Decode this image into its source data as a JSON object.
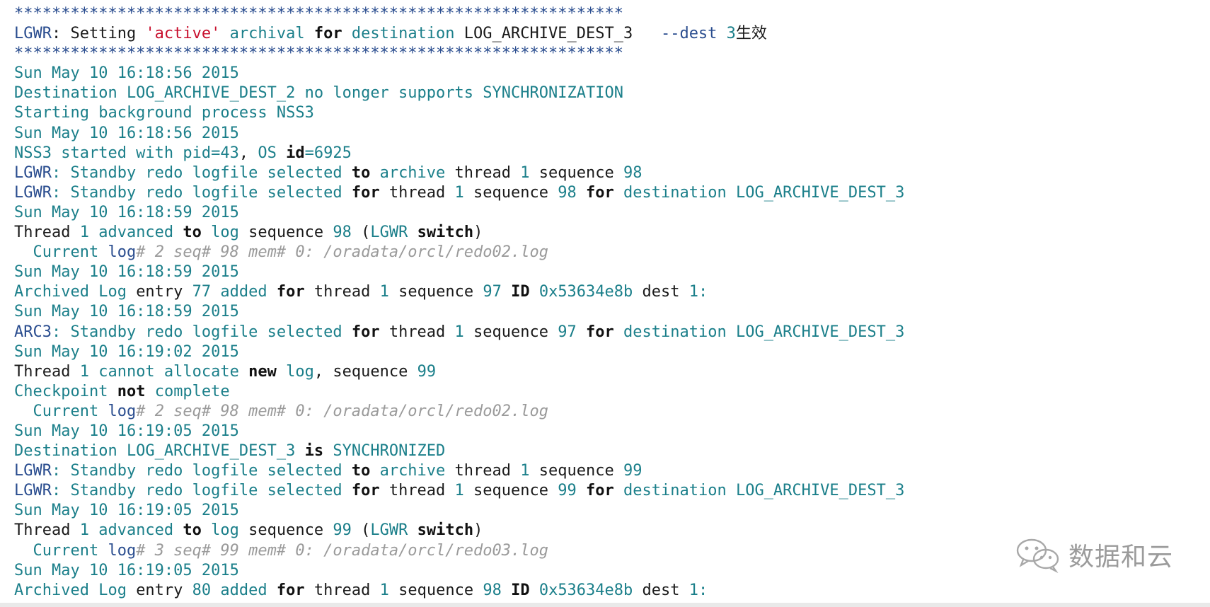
{
  "colors": {
    "d": "#1a1a1a",
    "t": "#1b7f8a",
    "n": "#2a4d8f",
    "k": "#111111",
    "s": "#c8102e",
    "c": "#9a9a9a"
  },
  "lines": [
    [
      [
        "z",
        "*****************************************************************"
      ]
    ],
    [
      [
        "n",
        "LGWR"
      ],
      [
        "d",
        ": Setting "
      ],
      [
        "s",
        "'active'"
      ],
      [
        "t",
        " archival "
      ],
      [
        "k",
        "for"
      ],
      [
        "t",
        " destination "
      ],
      [
        "d",
        "LOG_ARCHIVE_DEST_3   "
      ],
      [
        "n",
        "--dest "
      ],
      [
        "t",
        "3"
      ],
      [
        "d",
        "生效"
      ]
    ],
    [
      [
        "z",
        "*****************************************************************"
      ]
    ],
    [
      [
        "t",
        "Sun May 10 16:18:56 2015"
      ]
    ],
    [
      [
        "t",
        "Destination LOG_ARCHIVE_DEST_2 no longer supports SYNCHRONIZATION"
      ]
    ],
    [
      [
        "t",
        "Starting background process NSS3"
      ]
    ],
    [
      [
        "t",
        "Sun May 10 16:18:56 2015"
      ]
    ],
    [
      [
        "t",
        "NSS3 started with pid="
      ],
      [
        "t",
        "43"
      ],
      [
        "d",
        ", "
      ],
      [
        "t",
        "OS "
      ],
      [
        "k",
        "id"
      ],
      [
        "t",
        "=6925"
      ]
    ],
    [
      [
        "n",
        "LGWR"
      ],
      [
        "t",
        ": Standby redo logfile selected "
      ],
      [
        "k",
        "to"
      ],
      [
        "t",
        " archive "
      ],
      [
        "d",
        "thread "
      ],
      [
        "t",
        "1 "
      ],
      [
        "d",
        "sequence "
      ],
      [
        "t",
        "98"
      ]
    ],
    [
      [
        "n",
        "LGWR"
      ],
      [
        "t",
        ": Standby redo logfile selected "
      ],
      [
        "k",
        "for"
      ],
      [
        "d",
        " thread "
      ],
      [
        "t",
        "1 "
      ],
      [
        "d",
        "sequence "
      ],
      [
        "t",
        "98 "
      ],
      [
        "k",
        "for"
      ],
      [
        "t",
        " destination LOG_ARCHIVE_DEST_3"
      ]
    ],
    [
      [
        "t",
        "Sun May 10 16:18:59 2015"
      ]
    ],
    [
      [
        "d",
        "Thread "
      ],
      [
        "t",
        "1 advanced "
      ],
      [
        "k",
        "to"
      ],
      [
        "t",
        " log "
      ],
      [
        "d",
        "sequence "
      ],
      [
        "t",
        "98 "
      ],
      [
        "d",
        "("
      ],
      [
        "t",
        "LGWR "
      ],
      [
        "k",
        "switch"
      ],
      [
        "d",
        ")"
      ]
    ],
    [
      [
        "t",
        "  Current "
      ],
      [
        "n",
        "log"
      ],
      [
        "c",
        "# 2 seq# 98 mem# 0: /oradata/orcl/redo02.log"
      ]
    ],
    [
      [
        "t",
        "Sun May 10 16:18:59 2015"
      ]
    ],
    [
      [
        "t",
        "Archived Log "
      ],
      [
        "d",
        "entry "
      ],
      [
        "t",
        "77 added "
      ],
      [
        "k",
        "for"
      ],
      [
        "d",
        " thread "
      ],
      [
        "t",
        "1 "
      ],
      [
        "d",
        "sequence "
      ],
      [
        "t",
        "97 "
      ],
      [
        "k",
        "ID"
      ],
      [
        "t",
        " 0x53634e8b "
      ],
      [
        "d",
        "dest "
      ],
      [
        "t",
        "1:"
      ]
    ],
    [
      [
        "t",
        "Sun May 10 16:18:59 2015"
      ]
    ],
    [
      [
        "n",
        "ARC3"
      ],
      [
        "t",
        ": Standby redo logfile selected "
      ],
      [
        "k",
        "for"
      ],
      [
        "d",
        " thread "
      ],
      [
        "t",
        "1 "
      ],
      [
        "d",
        "sequence "
      ],
      [
        "t",
        "97 "
      ],
      [
        "k",
        "for"
      ],
      [
        "t",
        " destination LOG_ARCHIVE_DEST_3"
      ]
    ],
    [
      [
        "t",
        "Sun May 10 16:19:02 2015"
      ]
    ],
    [
      [
        "d",
        "Thread "
      ],
      [
        "t",
        "1 cannot allocate "
      ],
      [
        "k",
        "new"
      ],
      [
        "t",
        " log"
      ],
      [
        "d",
        ", sequence "
      ],
      [
        "t",
        "99"
      ]
    ],
    [
      [
        "t",
        "Checkpoint "
      ],
      [
        "k",
        "not"
      ],
      [
        "t",
        " complete"
      ]
    ],
    [
      [
        "t",
        "  Current "
      ],
      [
        "n",
        "log"
      ],
      [
        "c",
        "# 2 seq# 98 mem# 0: /oradata/orcl/redo02.log"
      ]
    ],
    [
      [
        "t",
        "Sun May 10 16:19:05 2015"
      ]
    ],
    [
      [
        "t",
        "Destination LOG_ARCHIVE_DEST_3 "
      ],
      [
        "k",
        "is"
      ],
      [
        "t",
        " SYNCHRONIZED"
      ]
    ],
    [
      [
        "n",
        "LGWR"
      ],
      [
        "t",
        ": Standby redo logfile selected "
      ],
      [
        "k",
        "to"
      ],
      [
        "t",
        " archive "
      ],
      [
        "d",
        "thread "
      ],
      [
        "t",
        "1 "
      ],
      [
        "d",
        "sequence "
      ],
      [
        "t",
        "99"
      ]
    ],
    [
      [
        "n",
        "LGWR"
      ],
      [
        "t",
        ": Standby redo logfile selected "
      ],
      [
        "k",
        "for"
      ],
      [
        "d",
        " thread "
      ],
      [
        "t",
        "1 "
      ],
      [
        "d",
        "sequence "
      ],
      [
        "t",
        "99 "
      ],
      [
        "k",
        "for"
      ],
      [
        "t",
        " destination LOG_ARCHIVE_DEST_3"
      ]
    ],
    [
      [
        "t",
        "Sun May 10 16:19:05 2015"
      ]
    ],
    [
      [
        "d",
        "Thread "
      ],
      [
        "t",
        "1 advanced "
      ],
      [
        "k",
        "to"
      ],
      [
        "t",
        " log "
      ],
      [
        "d",
        "sequence "
      ],
      [
        "t",
        "99 "
      ],
      [
        "d",
        "("
      ],
      [
        "t",
        "LGWR "
      ],
      [
        "k",
        "switch"
      ],
      [
        "d",
        ")"
      ]
    ],
    [
      [
        "t",
        "  Current "
      ],
      [
        "n",
        "log"
      ],
      [
        "c",
        "# 3 seq# 99 mem# 0: /oradata/orcl/redo03.log"
      ]
    ],
    [
      [
        "t",
        "Sun May 10 16:19:05 2015"
      ]
    ],
    [
      [
        "t",
        "Archived Log "
      ],
      [
        "d",
        "entry "
      ],
      [
        "t",
        "80 added "
      ],
      [
        "k",
        "for"
      ],
      [
        "d",
        " thread "
      ],
      [
        "t",
        "1 "
      ],
      [
        "d",
        "sequence "
      ],
      [
        "t",
        "98 "
      ],
      [
        "k",
        "ID"
      ],
      [
        "t",
        " 0x53634e8b "
      ],
      [
        "d",
        "dest "
      ],
      [
        "t",
        "1:"
      ]
    ]
  ],
  "watermark": {
    "text": "数据和云",
    "icon": "wechat-icon"
  }
}
